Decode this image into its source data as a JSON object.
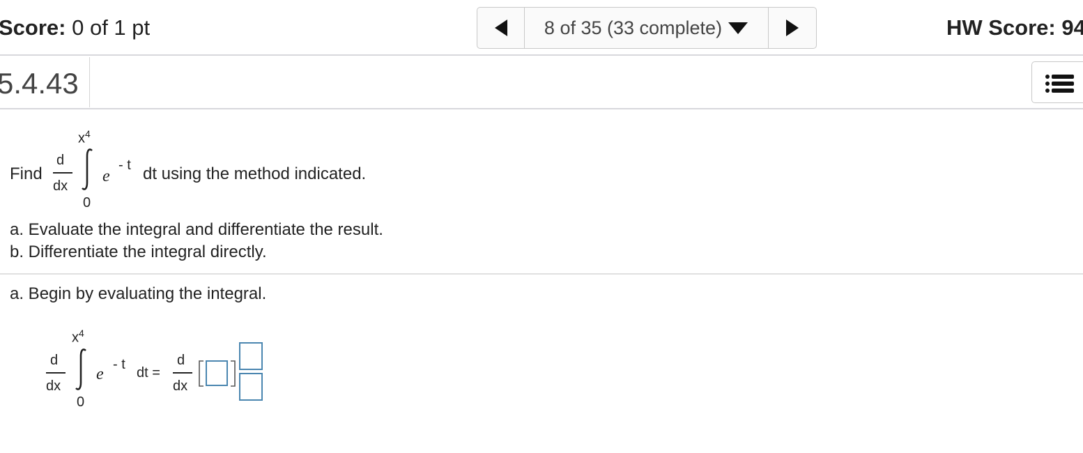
{
  "header": {
    "score_label": "Score:",
    "score_value": "0 of 1 pt",
    "nav_progress": "8 of 35 (33 complete)",
    "hw_score": "HW Score: 94"
  },
  "question": {
    "number": "5.4.43"
  },
  "problem": {
    "find_word": "Find",
    "d": "d",
    "dx": "dx",
    "upper_limit_base": "x",
    "upper_limit_exp": "4",
    "lower_limit": "0",
    "integrand_base": "e",
    "integrand_exp": "- t",
    "trailing_text": "dt using the method indicated.",
    "part_a": "a. Evaluate the integral and differentiate the result.",
    "part_b": "b. Differentiate the integral directly."
  },
  "step": {
    "instruction": "a. Begin by evaluating the integral.",
    "dt_equals": "dt =",
    "answer_value_1": "",
    "answer_numerator": "",
    "answer_denominator": ""
  },
  "colors": {
    "input_border": "#4a86b0",
    "rule": "#d7d7dc"
  }
}
